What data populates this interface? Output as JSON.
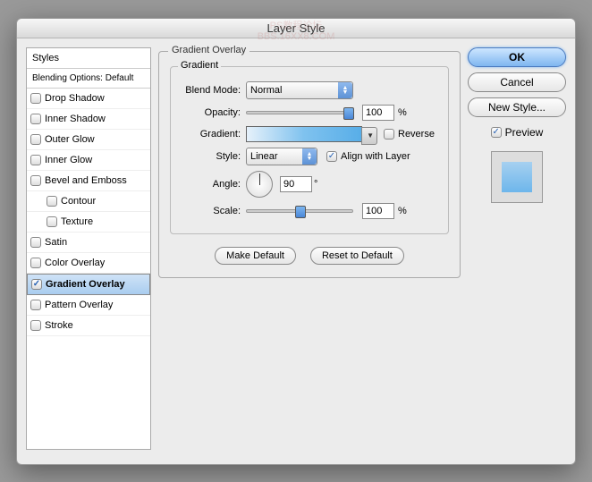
{
  "dialog": {
    "title": "Layer Style"
  },
  "watermark": {
    "line1": "PS教程论坛",
    "line2": "BBS.16XX8.COM"
  },
  "styles": {
    "header": "Styles",
    "blending": "Blending Options: Default",
    "items": [
      {
        "label": "Drop Shadow",
        "checked": false
      },
      {
        "label": "Inner Shadow",
        "checked": false
      },
      {
        "label": "Outer Glow",
        "checked": false
      },
      {
        "label": "Inner Glow",
        "checked": false
      },
      {
        "label": "Bevel and Emboss",
        "checked": false
      },
      {
        "label": "Contour",
        "checked": false,
        "indent": true
      },
      {
        "label": "Texture",
        "checked": false,
        "indent": true
      },
      {
        "label": "Satin",
        "checked": false
      },
      {
        "label": "Color Overlay",
        "checked": false
      },
      {
        "label": "Gradient Overlay",
        "checked": true,
        "selected": true
      },
      {
        "label": "Pattern Overlay",
        "checked": false
      },
      {
        "label": "Stroke",
        "checked": false
      }
    ]
  },
  "main": {
    "section_title": "Gradient Overlay",
    "gradient_title": "Gradient",
    "blend_mode": {
      "label": "Blend Mode:",
      "value": "Normal"
    },
    "opacity": {
      "label": "Opacity:",
      "value": "100",
      "unit": "%"
    },
    "gradient": {
      "label": "Gradient:",
      "reverse_label": "Reverse",
      "reverse_checked": false
    },
    "style": {
      "label": "Style:",
      "value": "Linear",
      "align_label": "Align with Layer",
      "align_checked": true
    },
    "angle": {
      "label": "Angle:",
      "value": "90",
      "unit": "°"
    },
    "scale": {
      "label": "Scale:",
      "value": "100",
      "unit": "%"
    },
    "make_default": "Make Default",
    "reset_default": "Reset to Default"
  },
  "right": {
    "ok": "OK",
    "cancel": "Cancel",
    "new_style": "New Style...",
    "preview_label": "Preview",
    "preview_checked": true
  }
}
